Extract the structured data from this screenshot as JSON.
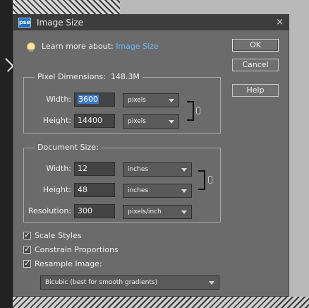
{
  "window": {
    "app_icon_text": "pse",
    "title": "Image Size",
    "close_glyph": "×"
  },
  "learn_more": {
    "prefix": "Learn more about:",
    "link": "Image Size"
  },
  "buttons": {
    "ok": "OK",
    "cancel": "Cancel",
    "help": "Help"
  },
  "pixel_dimensions": {
    "title": "Pixel Dimensions:",
    "size": "148.3M",
    "width_label": "Width:",
    "width_value": "3600",
    "width_unit": "pixels",
    "height_label": "Height:",
    "height_value": "14400",
    "height_unit": "pixels"
  },
  "document_size": {
    "title": "Document Size:",
    "width_label": "Width:",
    "width_value": "12",
    "width_unit": "inches",
    "height_label": "Height:",
    "height_value": "48",
    "height_unit": "inches",
    "resolution_label": "Resolution:",
    "resolution_value": "300",
    "resolution_unit": "pixels/inch"
  },
  "options": {
    "scale_styles": {
      "label": "Scale Styles",
      "checked": true
    },
    "constrain_proportions": {
      "label": "Constrain Proportions",
      "checked": true
    },
    "resample_image": {
      "label": "Resample Image:",
      "checked": true
    },
    "resample_method": "Bicubic (best for smooth gradients)"
  },
  "icons": {
    "lightbulb": "lightbulb-icon",
    "chain": "chain-link-icon",
    "check": "✓"
  },
  "colors": {
    "dialog_bg": "#6b6b6b",
    "titlebar_bg": "#3d3d3d",
    "link": "#6ab8ff",
    "selection": "#3b78c8"
  }
}
